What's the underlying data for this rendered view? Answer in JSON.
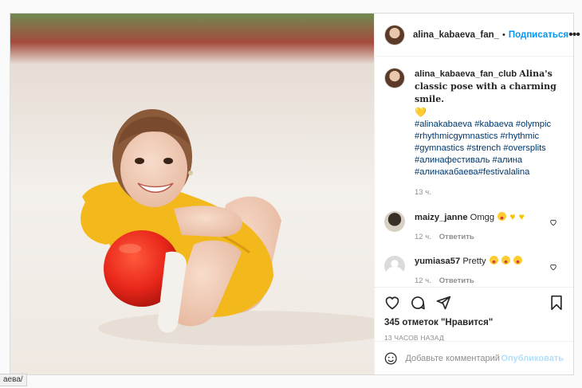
{
  "header": {
    "username": "alina_kabaeva_fan_",
    "follow_label": "Подписаться",
    "more_label": "•••"
  },
  "caption": {
    "username": "alina_kabaeva_fan_club",
    "text": "Alina's classic pose with a charming smile.",
    "emoji": "💛",
    "hashtags": "#alinakabaeva #kabaeva #olympic #rhythmicgymnastics #rhythmic #gymnastics #strench #oversplits #алинафестиваль #алина #алинакабаева#festivalalina",
    "time": "13 ч."
  },
  "comments": [
    {
      "username": "maizy_janne",
      "text": "Omgg",
      "time": "12 ч.",
      "reply_label": "Ответить"
    },
    {
      "username": "yumiasa57",
      "text": "Pretty",
      "time": "12 ч.",
      "reply_label": "Ответить"
    }
  ],
  "actions": {
    "likes": "345 отметок \"Нравится\"",
    "time_ago": "13 ЧАСОВ НАЗАД"
  },
  "add_comment": {
    "placeholder": "Добавьте комментарий...",
    "publish_label": "Опубликовать"
  },
  "status_bar": {
    "text": "аева/"
  },
  "colors": {
    "link": "#0095f6",
    "hashtag": "#00376b",
    "muted": "#8e8e8e",
    "publish_disabled": "#b2dffc"
  }
}
